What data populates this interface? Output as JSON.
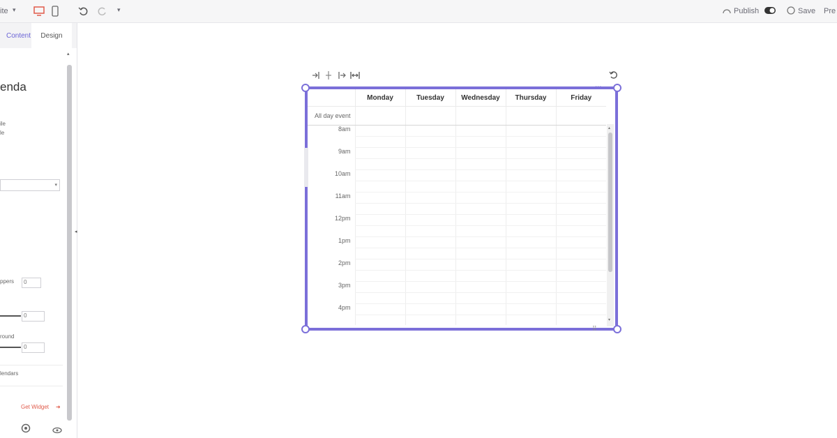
{
  "toolbar": {
    "left_menu_label": "ite",
    "publish_label": "Publish",
    "save_label": "Save",
    "preview_label": "Pre"
  },
  "panel": {
    "tab_content": "Content",
    "tab_design": "Design",
    "heading": "enda",
    "text_1": "ile",
    "text_2": "le",
    "label_a": "ppers",
    "value_a": "0",
    "value_b": "0",
    "label_c": "round",
    "value_c": "0",
    "calendars_label": "lendars",
    "footer_link": "Get Widget"
  },
  "calendar": {
    "allday_label": "All day event",
    "days": [
      "Monday",
      "Tuesday",
      "Wednesday",
      "Thursday",
      "Friday"
    ],
    "hours": [
      "8am",
      "9am",
      "10am",
      "11am",
      "12pm",
      "1pm",
      "2pm",
      "3pm",
      "4pm"
    ]
  },
  "colors": {
    "accent": "#7b6fd9",
    "link": "#e05a4a"
  }
}
